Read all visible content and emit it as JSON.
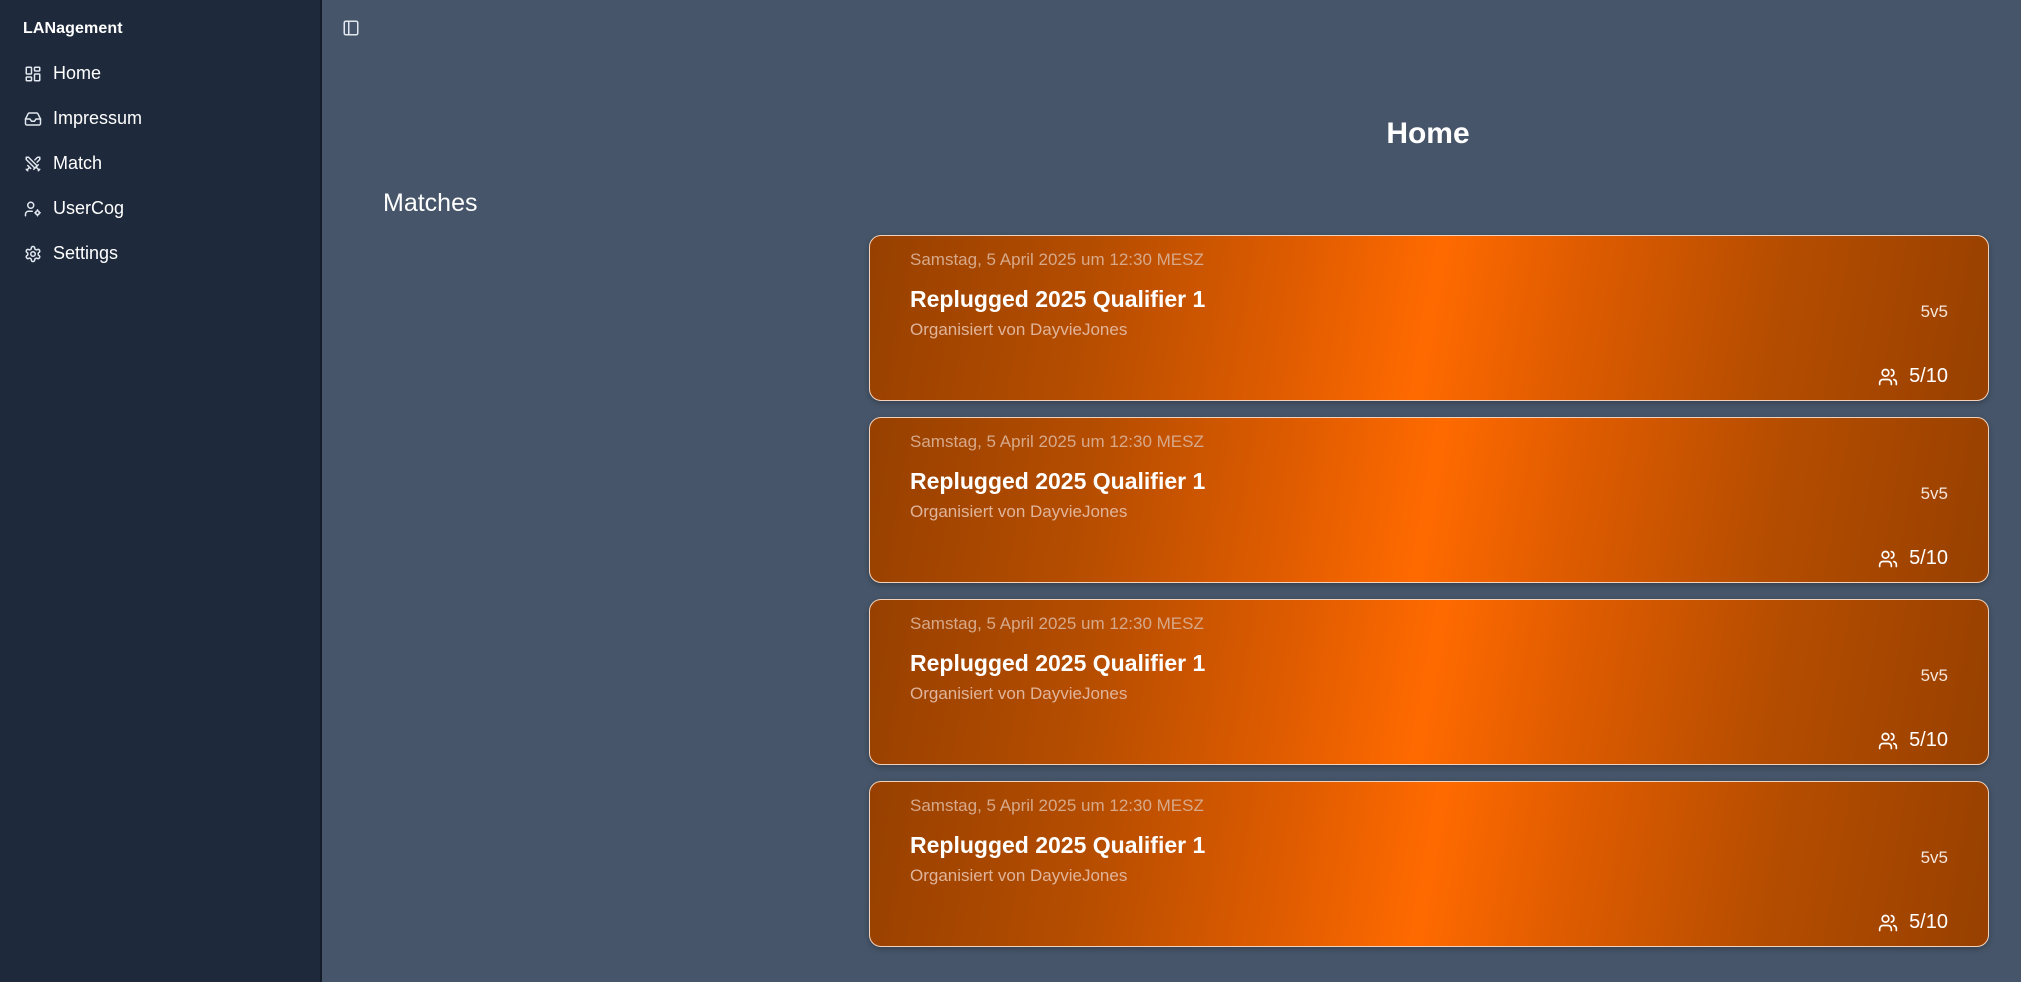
{
  "sidebar": {
    "app_title": "LANagement",
    "items": [
      {
        "label": "Home",
        "icon": "layout-dashboard-icon"
      },
      {
        "label": "Impressum",
        "icon": "inbox-icon"
      },
      {
        "label": "Match",
        "icon": "swords-icon"
      },
      {
        "label": "UserCog",
        "icon": "user-cog-icon"
      },
      {
        "label": "Settings",
        "icon": "gear-icon"
      }
    ]
  },
  "header": {
    "toggle_icon": "panel-left-icon"
  },
  "main": {
    "title": "Home",
    "section_title": "Matches",
    "matches": [
      {
        "date": "Samstag, 5 April 2025 um 12:30 MESZ",
        "title": "Replugged 2025 Qualifier 1",
        "organizer": "Organisiert von DayvieJones",
        "mode": "5v5",
        "players": "5/10"
      },
      {
        "date": "Samstag, 5 April 2025 um 12:30 MESZ",
        "title": "Replugged 2025 Qualifier 1",
        "organizer": "Organisiert von DayvieJones",
        "mode": "5v5",
        "players": "5/10"
      },
      {
        "date": "Samstag, 5 April 2025 um 12:30 MESZ",
        "title": "Replugged 2025 Qualifier 1",
        "organizer": "Organisiert von DayvieJones",
        "mode": "5v5",
        "players": "5/10"
      },
      {
        "date": "Samstag, 5 April 2025 um 12:30 MESZ",
        "title": "Replugged 2025 Qualifier 1",
        "organizer": "Organisiert von DayvieJones",
        "mode": "5v5",
        "players": "5/10"
      }
    ]
  },
  "colors": {
    "sidebar_bg": "#1e293b",
    "main_bg": "#465569",
    "card_accent": "#ff6a00",
    "card_dark": "#974000"
  }
}
